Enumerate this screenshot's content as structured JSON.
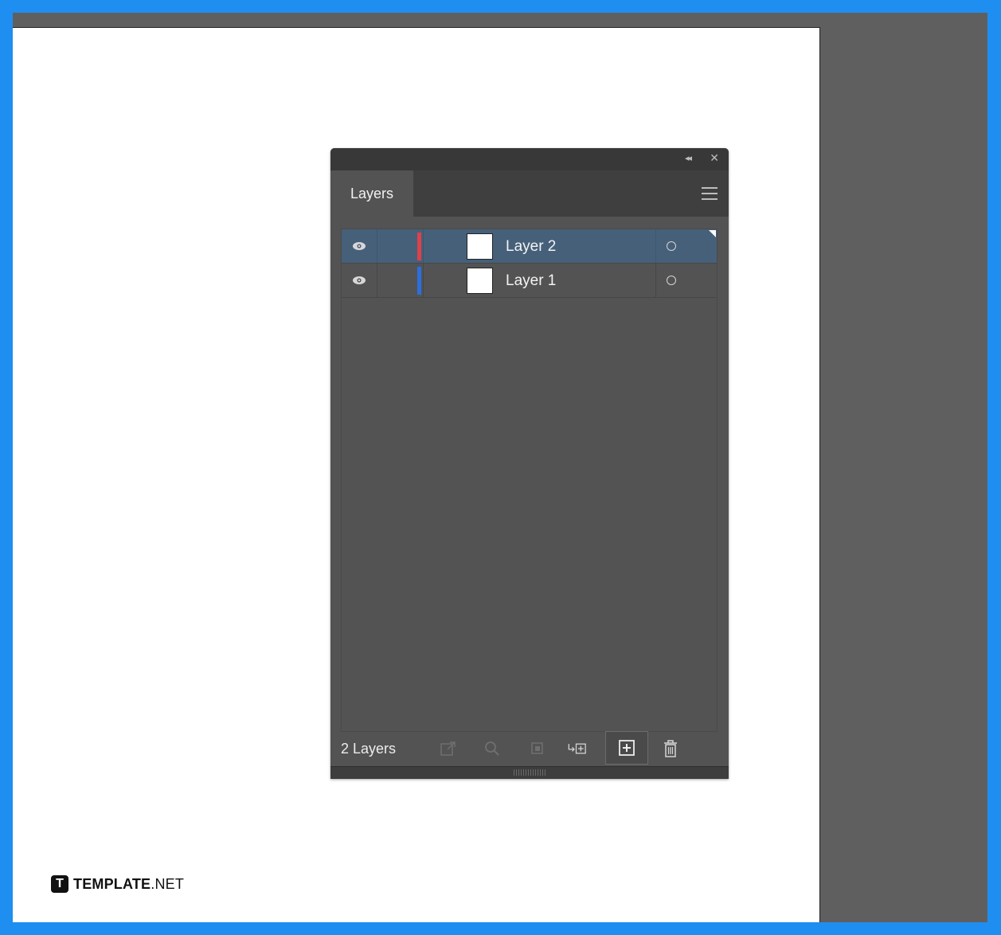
{
  "panel": {
    "tab_label": "Layers",
    "collapse_glyph": "◂◂",
    "close_glyph": "✕"
  },
  "layers": [
    {
      "name": "Layer 2",
      "color": "#e0404a",
      "selected": true,
      "visible": true
    },
    {
      "name": "Layer 1",
      "color": "#2a6fe0",
      "selected": false,
      "visible": true
    }
  ],
  "footer": {
    "count_label": "2 Layers",
    "icons": [
      "collect-for-export-icon",
      "locate-object-icon",
      "make-clipping-mask-icon",
      "create-sublayer-icon",
      "create-new-layer-icon",
      "delete-layer-icon"
    ]
  },
  "colors": {
    "accent_border": "#1e8ef0",
    "panel_bg": "#535353",
    "selected_row": "#46607a"
  },
  "watermark": {
    "logo_letter": "T",
    "brand_bold": "TEMPLATE",
    "brand_suffix": ".NET"
  }
}
